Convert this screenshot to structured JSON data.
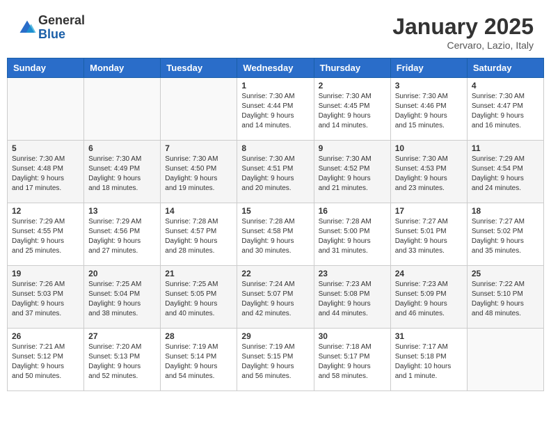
{
  "header": {
    "logo_general": "General",
    "logo_blue": "Blue",
    "month_title": "January 2025",
    "subtitle": "Cervaro, Lazio, Italy"
  },
  "days_of_week": [
    "Sunday",
    "Monday",
    "Tuesday",
    "Wednesday",
    "Thursday",
    "Friday",
    "Saturday"
  ],
  "weeks": [
    [
      {
        "day": "",
        "info": ""
      },
      {
        "day": "",
        "info": ""
      },
      {
        "day": "",
        "info": ""
      },
      {
        "day": "1",
        "info": "Sunrise: 7:30 AM\nSunset: 4:44 PM\nDaylight: 9 hours\nand 14 minutes."
      },
      {
        "day": "2",
        "info": "Sunrise: 7:30 AM\nSunset: 4:45 PM\nDaylight: 9 hours\nand 14 minutes."
      },
      {
        "day": "3",
        "info": "Sunrise: 7:30 AM\nSunset: 4:46 PM\nDaylight: 9 hours\nand 15 minutes."
      },
      {
        "day": "4",
        "info": "Sunrise: 7:30 AM\nSunset: 4:47 PM\nDaylight: 9 hours\nand 16 minutes."
      }
    ],
    [
      {
        "day": "5",
        "info": "Sunrise: 7:30 AM\nSunset: 4:48 PM\nDaylight: 9 hours\nand 17 minutes."
      },
      {
        "day": "6",
        "info": "Sunrise: 7:30 AM\nSunset: 4:49 PM\nDaylight: 9 hours\nand 18 minutes."
      },
      {
        "day": "7",
        "info": "Sunrise: 7:30 AM\nSunset: 4:50 PM\nDaylight: 9 hours\nand 19 minutes."
      },
      {
        "day": "8",
        "info": "Sunrise: 7:30 AM\nSunset: 4:51 PM\nDaylight: 9 hours\nand 20 minutes."
      },
      {
        "day": "9",
        "info": "Sunrise: 7:30 AM\nSunset: 4:52 PM\nDaylight: 9 hours\nand 21 minutes."
      },
      {
        "day": "10",
        "info": "Sunrise: 7:30 AM\nSunset: 4:53 PM\nDaylight: 9 hours\nand 23 minutes."
      },
      {
        "day": "11",
        "info": "Sunrise: 7:29 AM\nSunset: 4:54 PM\nDaylight: 9 hours\nand 24 minutes."
      }
    ],
    [
      {
        "day": "12",
        "info": "Sunrise: 7:29 AM\nSunset: 4:55 PM\nDaylight: 9 hours\nand 25 minutes."
      },
      {
        "day": "13",
        "info": "Sunrise: 7:29 AM\nSunset: 4:56 PM\nDaylight: 9 hours\nand 27 minutes."
      },
      {
        "day": "14",
        "info": "Sunrise: 7:28 AM\nSunset: 4:57 PM\nDaylight: 9 hours\nand 28 minutes."
      },
      {
        "day": "15",
        "info": "Sunrise: 7:28 AM\nSunset: 4:58 PM\nDaylight: 9 hours\nand 30 minutes."
      },
      {
        "day": "16",
        "info": "Sunrise: 7:28 AM\nSunset: 5:00 PM\nDaylight: 9 hours\nand 31 minutes."
      },
      {
        "day": "17",
        "info": "Sunrise: 7:27 AM\nSunset: 5:01 PM\nDaylight: 9 hours\nand 33 minutes."
      },
      {
        "day": "18",
        "info": "Sunrise: 7:27 AM\nSunset: 5:02 PM\nDaylight: 9 hours\nand 35 minutes."
      }
    ],
    [
      {
        "day": "19",
        "info": "Sunrise: 7:26 AM\nSunset: 5:03 PM\nDaylight: 9 hours\nand 37 minutes."
      },
      {
        "day": "20",
        "info": "Sunrise: 7:25 AM\nSunset: 5:04 PM\nDaylight: 9 hours\nand 38 minutes."
      },
      {
        "day": "21",
        "info": "Sunrise: 7:25 AM\nSunset: 5:05 PM\nDaylight: 9 hours\nand 40 minutes."
      },
      {
        "day": "22",
        "info": "Sunrise: 7:24 AM\nSunset: 5:07 PM\nDaylight: 9 hours\nand 42 minutes."
      },
      {
        "day": "23",
        "info": "Sunrise: 7:23 AM\nSunset: 5:08 PM\nDaylight: 9 hours\nand 44 minutes."
      },
      {
        "day": "24",
        "info": "Sunrise: 7:23 AM\nSunset: 5:09 PM\nDaylight: 9 hours\nand 46 minutes."
      },
      {
        "day": "25",
        "info": "Sunrise: 7:22 AM\nSunset: 5:10 PM\nDaylight: 9 hours\nand 48 minutes."
      }
    ],
    [
      {
        "day": "26",
        "info": "Sunrise: 7:21 AM\nSunset: 5:12 PM\nDaylight: 9 hours\nand 50 minutes."
      },
      {
        "day": "27",
        "info": "Sunrise: 7:20 AM\nSunset: 5:13 PM\nDaylight: 9 hours\nand 52 minutes."
      },
      {
        "day": "28",
        "info": "Sunrise: 7:19 AM\nSunset: 5:14 PM\nDaylight: 9 hours\nand 54 minutes."
      },
      {
        "day": "29",
        "info": "Sunrise: 7:19 AM\nSunset: 5:15 PM\nDaylight: 9 hours\nand 56 minutes."
      },
      {
        "day": "30",
        "info": "Sunrise: 7:18 AM\nSunset: 5:17 PM\nDaylight: 9 hours\nand 58 minutes."
      },
      {
        "day": "31",
        "info": "Sunrise: 7:17 AM\nSunset: 5:18 PM\nDaylight: 10 hours\nand 1 minute."
      },
      {
        "day": "",
        "info": ""
      }
    ]
  ]
}
